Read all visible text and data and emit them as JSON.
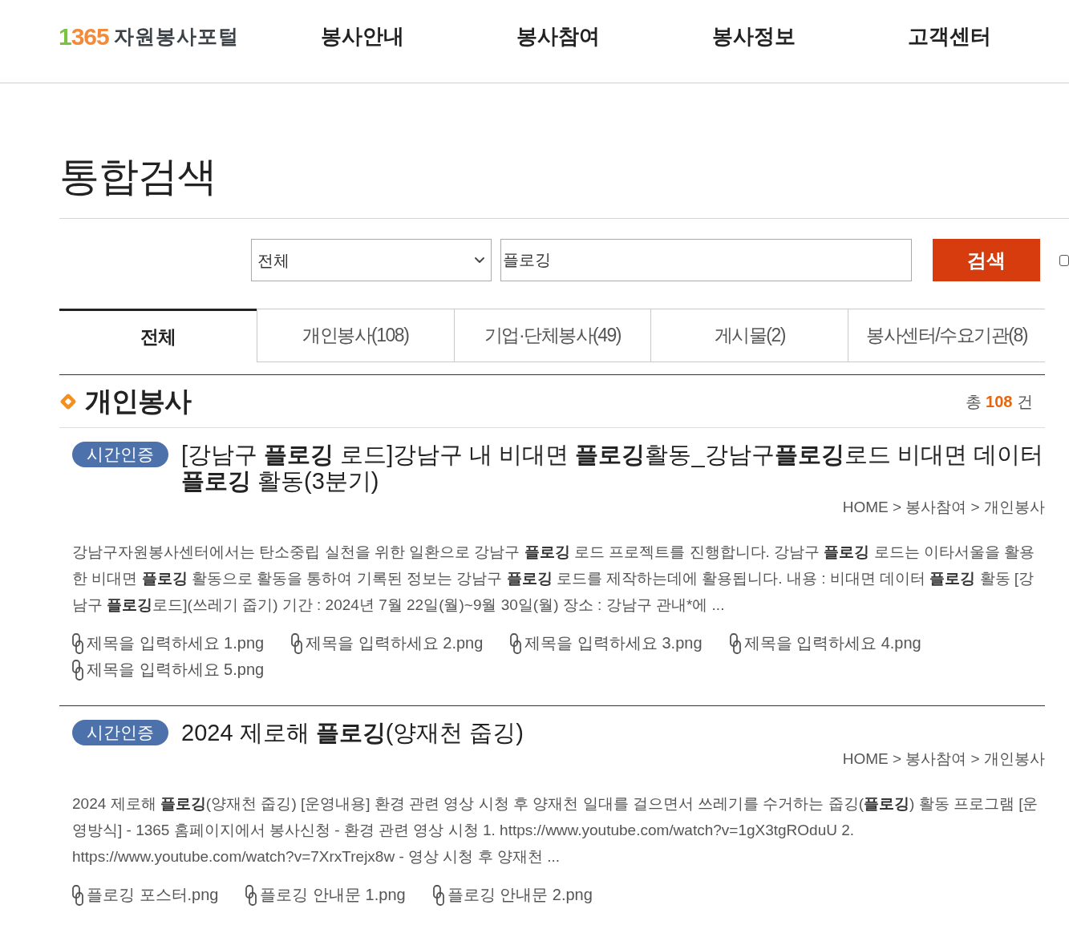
{
  "header": {
    "logo": {
      "number": "1365",
      "name": "자원봉사포털"
    },
    "nav": [
      "봉사안내",
      "봉사참여",
      "봉사정보",
      "고객센터"
    ]
  },
  "page_title": "통합검색",
  "search": {
    "category": "전체",
    "query": "플로깅",
    "button": "검색",
    "checkbox": {
      "checked": false
    }
  },
  "tabs": [
    {
      "label": "전체",
      "selected": true
    },
    {
      "label": "개인봉사(108)",
      "selected": false
    },
    {
      "label": "기업·단체봉사(49)",
      "selected": false
    },
    {
      "label": "게시물(2)",
      "selected": false
    },
    {
      "label": "봉사센터/수요기관(8)",
      "selected": false
    }
  ],
  "section": {
    "title": "개인봉사",
    "total": {
      "prefix": "총",
      "count": "108",
      "suffix": "건"
    }
  },
  "results": [
    {
      "badge": "시간인증",
      "title": "[강남구 **플로깅** 로드]강남구 내 비대면 **플로깅**활동_강남구**플로깅**로드 비대면 데이터 **플로깅** 활동(3분기)",
      "breadcrumb": "HOME > 봉사참여 > 개인봉사",
      "description": "강남구자원봉사센터에서는 탄소중립 실천을 위한 일환으로 강남구 **플로깅** 로드 프로젝트를 진행합니다. 강남구 **플로깅** 로드는 이타서울을 활용한 비대면 **플로깅** 활동으로 활동을 통하여 기록된 정보는 강남구 **플로깅** 로드를 제작하는데에 활용됩니다. 내용 : 비대면 데이터 **플로깅** 활동 [강남구 **플로깅**로드](쓰레기 줍기) 기간 : 2024년 7월 22일(월)~9월 30일(월) 장소 : 강남구 관내*에 ...",
      "attachments": [
        "제목을 입력하세요 1.png",
        "제목을 입력하세요 2.png",
        "제목을 입력하세요 3.png",
        "제목을 입력하세요 4.png",
        "제목을 입력하세요 5.png"
      ]
    },
    {
      "badge": "시간인증",
      "title": "2024 제로해 **플로깅**(양재천 줍깅)",
      "breadcrumb": "HOME > 봉사참여 > 개인봉사",
      "description": "2024 제로해 **플로깅**(양재천 줍깅) [운영내용] 환경 관련 영상 시청 후 양재천 일대를 걸으면서 쓰레기를 수거하는 줍깅(**플로깅**) 활동 프로그램 [운영방식] - 1365 홈페이지에서 봉사신청 - 환경 관련 영상 시청 1. https://www.youtube.com/watch?v=1gX3tgROduU 2. https://www.youtube.com/watch?v=7XrxTrejx8w - 영상 시청 후 양재천 ...",
      "attachments": [
        "플로깅 포스터.png",
        "플로깅 안내문 1.png",
        "플로깅 안내문 2.png"
      ]
    }
  ]
}
